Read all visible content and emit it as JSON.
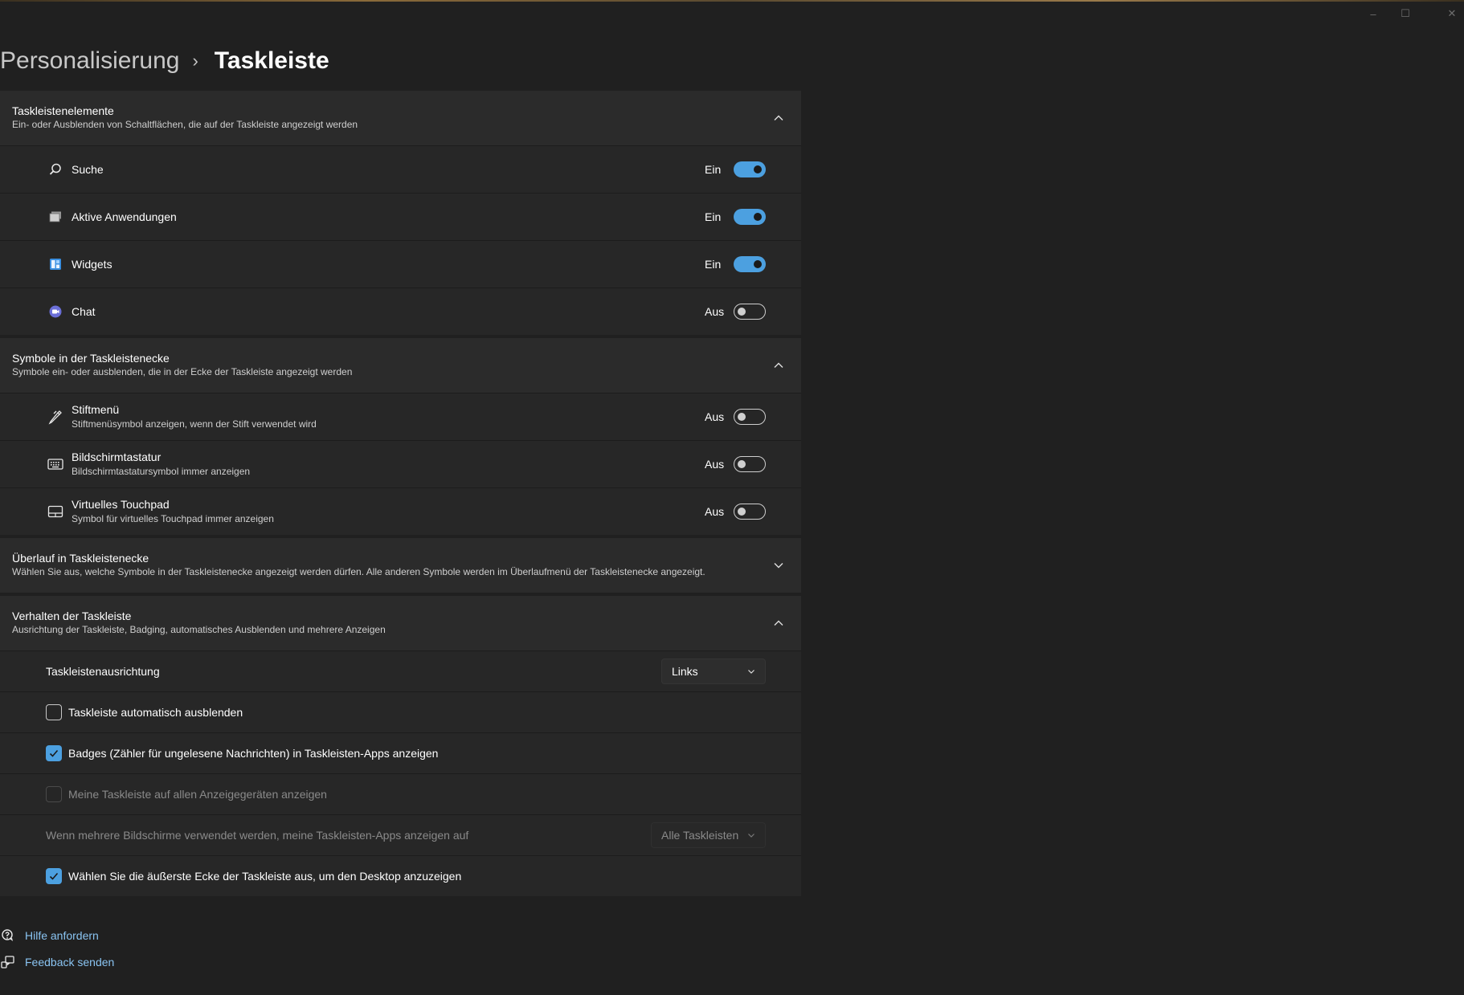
{
  "window": {
    "minimize_label": "–",
    "maximize_label": "☐",
    "close_label": "✕"
  },
  "breadcrumb": {
    "parent": "Personalisierung",
    "separator": "›",
    "current": "Taskleiste"
  },
  "sections": {
    "taskbar_items": {
      "title": "Taskleistenelemente",
      "description": "Ein- oder Ausblenden von Schaltflächen, die auf der Taskleiste angezeigt werden",
      "expanded": true,
      "items": [
        {
          "label": "Suche",
          "icon": "search-icon",
          "state": "Ein",
          "on": true
        },
        {
          "label": "Aktive Anwendungen",
          "icon": "task-view-icon",
          "state": "Ein",
          "on": true
        },
        {
          "label": "Widgets",
          "icon": "widgets-icon",
          "state": "Ein",
          "on": true
        },
        {
          "label": "Chat",
          "icon": "chat-icon",
          "state": "Aus",
          "on": false
        }
      ]
    },
    "corner_icons": {
      "title": "Symbole in der Taskleistenecke",
      "description": "Symbole ein- oder ausblenden, die in der Ecke der Taskleiste angezeigt werden",
      "expanded": true,
      "items": [
        {
          "label": "Stiftmenü",
          "sub": "Stiftmenüsymbol anzeigen, wenn der Stift verwendet wird",
          "icon": "pen-icon",
          "state": "Aus",
          "on": false
        },
        {
          "label": "Bildschirmtastatur",
          "sub": "Bildschirmtastatursymbol immer anzeigen",
          "icon": "keyboard-icon",
          "state": "Aus",
          "on": false
        },
        {
          "label": "Virtuelles Touchpad",
          "sub": "Symbol für virtuelles Touchpad immer anzeigen",
          "icon": "touchpad-icon",
          "state": "Aus",
          "on": false
        }
      ]
    },
    "overflow": {
      "title": "Überlauf in Taskleistenecke",
      "description": "Wählen Sie aus, welche Symbole in der Taskleistenecke angezeigt werden dürfen. Alle anderen Symbole werden im Überlaufmenü der Taskleistenecke angezeigt.",
      "expanded": false
    },
    "behavior": {
      "title": "Verhalten der Taskleiste",
      "description": "Ausrichtung der Taskleiste, Badging, automatisches Ausblenden und mehrere Anzeigen",
      "expanded": true,
      "alignment_label": "Taskleistenausrichtung",
      "alignment_value": "Links",
      "auto_hide_label": "Taskleiste automatisch ausblenden",
      "auto_hide_checked": false,
      "badges_label": "Badges (Zähler für ungelesene Nachrichten) in Taskleisten-Apps anzeigen",
      "badges_checked": true,
      "all_displays_label": "Meine Taskleiste auf allen Anzeigegeräten anzeigen",
      "all_displays_checked": false,
      "all_displays_disabled": true,
      "multi_monitor_label": "Wenn mehrere Bildschirme verwendet werden, meine Taskleisten-Apps anzeigen auf",
      "multi_monitor_value": "Alle Taskleisten",
      "multi_monitor_disabled": true,
      "far_corner_label": "Wählen Sie die äußerste Ecke der Taskleiste aus, um den Desktop anzuzeigen",
      "far_corner_checked": true
    }
  },
  "footer": {
    "help_label": "Hilfe anfordern",
    "help_icon": "help-chat-icon",
    "feedback_label": "Feedback senden",
    "feedback_icon": "feedback-icon"
  },
  "colors": {
    "background": "#202020",
    "card": "#2b2b2b",
    "accent": "#4ca0e0",
    "link": "#8ac4f2"
  }
}
